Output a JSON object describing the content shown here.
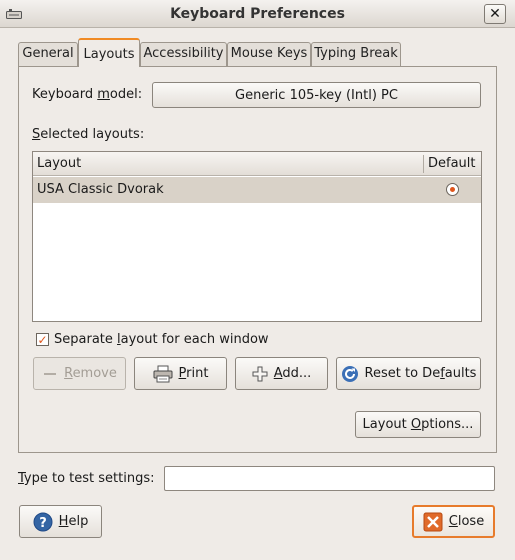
{
  "window": {
    "title": "Keyboard Preferences",
    "close_glyph": "✕"
  },
  "tabs": [
    {
      "label": "General"
    },
    {
      "label": "Layouts",
      "active": true
    },
    {
      "label": "Accessibility"
    },
    {
      "label": "Mouse Keys"
    },
    {
      "label": "Typing Break"
    }
  ],
  "keyboard_model": {
    "label_pre": "Keyboard ",
    "label_mnemonic": "m",
    "label_post": "odel:",
    "value": "Generic 105-key (Intl) PC"
  },
  "selected_layouts": {
    "label_mnemonic": "S",
    "label_post": "elected layouts:",
    "columns": {
      "layout": "Layout",
      "default": "Default"
    },
    "rows": [
      {
        "layout": "USA Classic Dvorak",
        "default": true
      }
    ]
  },
  "separate_layout": {
    "checked": true,
    "check_glyph": "✓",
    "label_pre": "Separate ",
    "label_mnemonic": "l",
    "label_post": "ayout for each window"
  },
  "buttons": {
    "remove": {
      "mnemonic": "R",
      "rest": "emove",
      "enabled": false
    },
    "print": {
      "mnemonic": "P",
      "rest": "rint"
    },
    "add": {
      "mnemonic": "A",
      "rest": "dd..."
    },
    "reset": {
      "pre": "Reset to De",
      "mnemonic": "f",
      "post": "aults"
    },
    "layout_options": {
      "pre": "Layout ",
      "mnemonic": "O",
      "post": "ptions..."
    },
    "help": {
      "mnemonic": "H",
      "rest": "elp"
    },
    "close": {
      "mnemonic": "C",
      "rest": "lose"
    }
  },
  "test_settings": {
    "label_mnemonic": "T",
    "label_post": "ype to test settings:",
    "value": "",
    "placeholder": ""
  },
  "icons": {
    "window_menu": "keyboard-icon",
    "remove": "minus-icon",
    "print": "printer-icon",
    "add": "plus-icon",
    "reset": "refresh-icon",
    "help": "help-icon",
    "close": "close-icon"
  },
  "colors": {
    "accent": "#f08a24",
    "selection_row": "#d9d2c8",
    "close_border": "#e77b2c",
    "radio_dot": "#e0561c"
  }
}
